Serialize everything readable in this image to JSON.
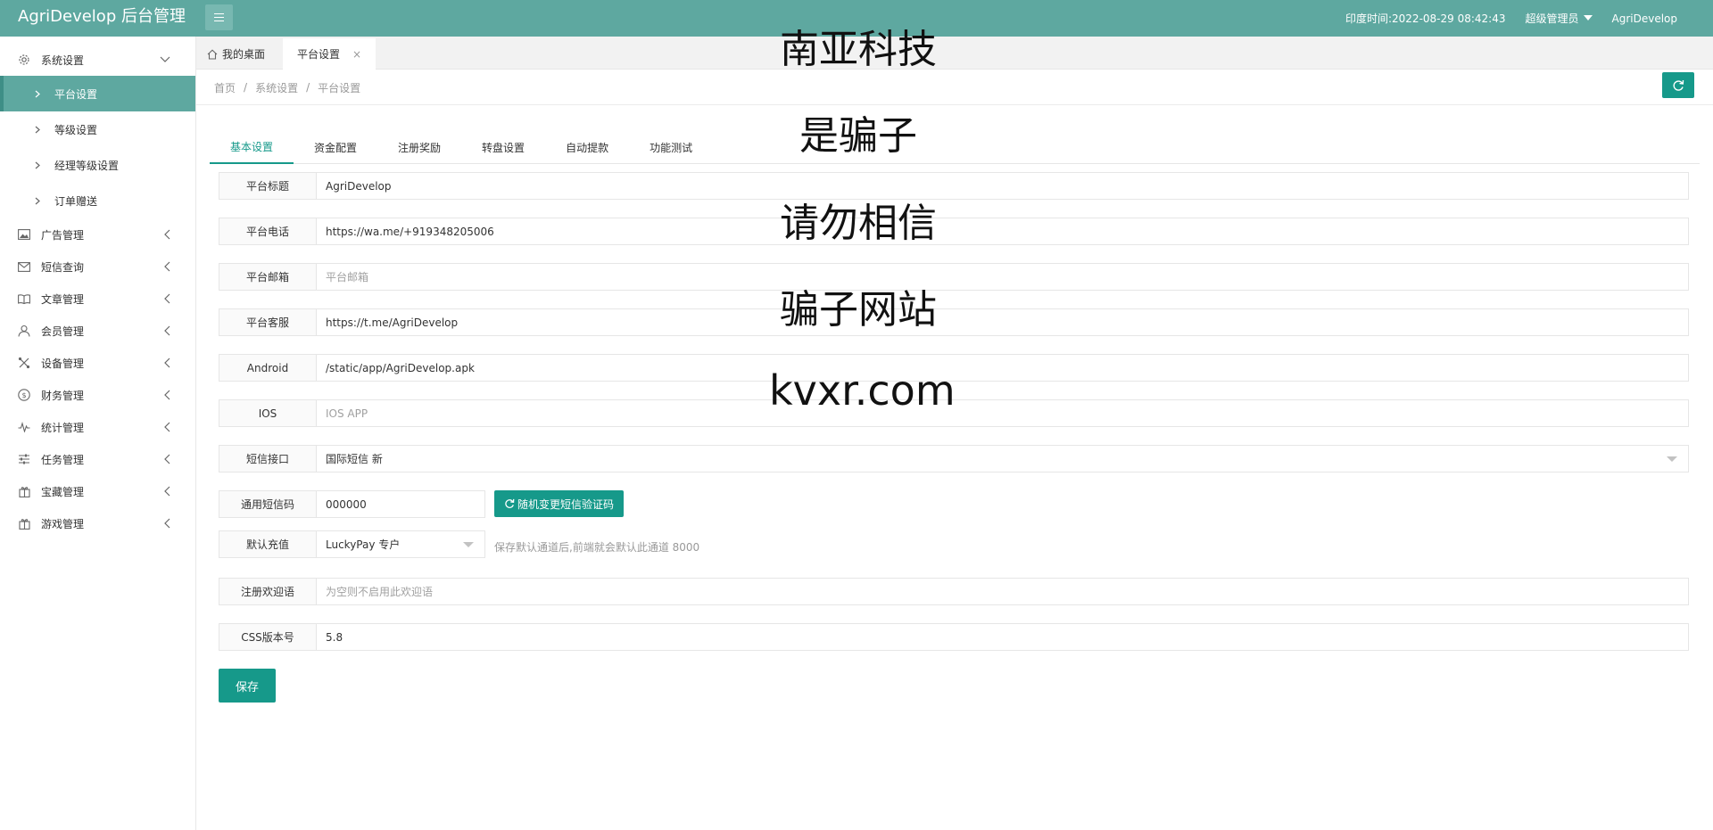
{
  "app": {
    "title": "AgriDevelop 后台管理"
  },
  "header": {
    "time_label": "印度时间:2022-08-29 08:42:43",
    "role_label": "超级管理员",
    "user_label": "AgriDevelop"
  },
  "sidebar": {
    "items": [
      {
        "label": "系统设置",
        "icon": "gear-icon",
        "expanded": true
      },
      {
        "label": "广告管理",
        "icon": "image-icon"
      },
      {
        "label": "短信查询",
        "icon": "mail-icon"
      },
      {
        "label": "文章管理",
        "icon": "book-icon"
      },
      {
        "label": "会员管理",
        "icon": "user-icon"
      },
      {
        "label": "设备管理",
        "icon": "tools-icon"
      },
      {
        "label": "财务管理",
        "icon": "dollar-icon"
      },
      {
        "label": "统计管理",
        "icon": "pulse-icon"
      },
      {
        "label": "任务管理",
        "icon": "sliders-icon"
      },
      {
        "label": "宝藏管理",
        "icon": "gift-icon"
      },
      {
        "label": "游戏管理",
        "icon": "gift-icon"
      }
    ],
    "subitems": [
      {
        "label": "平台设置",
        "active": true
      },
      {
        "label": "等级设置"
      },
      {
        "label": "经理等级设置"
      },
      {
        "label": "订单赠送"
      }
    ]
  },
  "page_tabs": [
    {
      "label": "我的桌面",
      "icon": "home-icon"
    },
    {
      "label": "平台设置",
      "active": true,
      "close": "×"
    }
  ],
  "breadcrumb": {
    "items": [
      "首页",
      "系统设置",
      "平台设置"
    ],
    "separator": "/"
  },
  "settings_tabs": [
    "基本设置",
    "资金配置",
    "注册奖励",
    "转盘设置",
    "自动提款",
    "功能测试"
  ],
  "form": {
    "fields": [
      {
        "label": "平台标题",
        "value": "AgriDevelop"
      },
      {
        "label": "平台电话",
        "value": "https://wa.me/+919348205006"
      },
      {
        "label": "平台邮箱",
        "value": "",
        "placeholder": "平台邮箱"
      },
      {
        "label": "平台客服",
        "value": "https://t.me/AgriDevelop"
      },
      {
        "label": "Android",
        "value": "/static/app/AgriDevelop.apk"
      },
      {
        "label": "IOS",
        "value": "",
        "placeholder": "IOS APP"
      },
      {
        "label": "短信接口",
        "value": "国际短信 新",
        "type": "select"
      },
      {
        "label": "通用短信码",
        "value": "000000"
      },
      {
        "label": "默认充值",
        "value": "LuckyPay 专户",
        "type": "select"
      },
      {
        "label": "注册欢迎语",
        "value": "",
        "placeholder": "为空则不启用此欢迎语"
      },
      {
        "label": "CSS版本号",
        "value": "5.8"
      }
    ],
    "generate_button_label": "随机变更短信验证码",
    "recharge_hint": "保存默认通道后,前端就会默认此通道 8000",
    "save_label": "保存"
  },
  "watermark": {
    "lines": [
      "南亚科技",
      "是骗子",
      "请勿相信",
      "骗子网站",
      "kvxr.com"
    ]
  },
  "colors": {
    "topbar": "#5ea8a0",
    "primary": "#16998a",
    "sidebar_active": "#5ea8a0"
  }
}
